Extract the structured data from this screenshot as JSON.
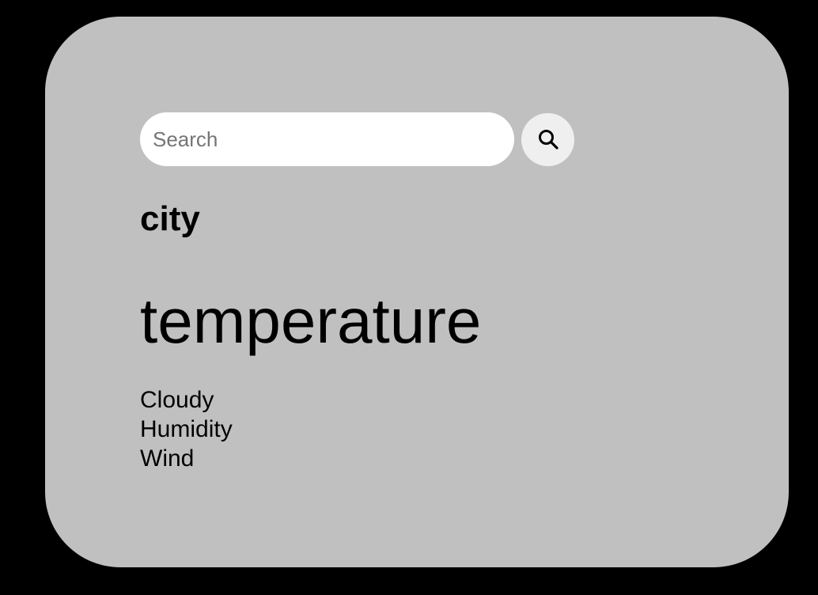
{
  "colors": {
    "background": "#000000",
    "card": "#c0c0c0",
    "search_field": "#ffffff",
    "search_button": "#efefef",
    "text": "#000000"
  },
  "search": {
    "placeholder": "Search",
    "value": "",
    "button_icon": "search-icon"
  },
  "weather": {
    "city": "city",
    "temperature": "temperature",
    "details": [
      "Cloudy",
      "Humidity",
      "Wind"
    ]
  }
}
